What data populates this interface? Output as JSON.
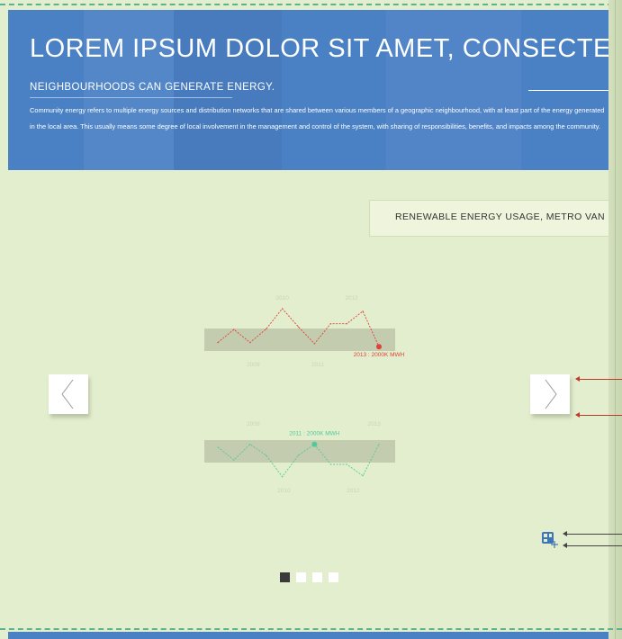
{
  "hero": {
    "title": "LOREM IPSUM DOLOR SIT AMET, CONSECTETUR",
    "subtitle": "NEIGHBOURHOODS CAN GENERATE ENERGY.",
    "body": "Community energy refers to multiple energy sources and distribution networks that are shared between various members of a geographic neighbourhood, with at least part of the energy generated in the local area. This usually means some degree of local involvement in the management and control of the system, with sharing of responsibilities, benefits, and impacts among the community."
  },
  "chart_box": {
    "title": "RENEWABLE ENERGY USAGE, METRO VAN"
  },
  "nav": {
    "prev_icon": "chevron-left-icon",
    "next_icon": "chevron-right-icon"
  },
  "tools": {
    "layout_icon": "layout-add-icon"
  },
  "pagination": {
    "count": 4,
    "active_index": 0
  },
  "colors": {
    "hero_bg": "#4a81c5",
    "page_bg": "#e2eecd",
    "red_series": "#e0413a",
    "green_series": "#53c99a",
    "band": "#c3ccae",
    "pointer_red": "#c0392b",
    "pager_active": "#3a3a3a"
  },
  "chart_data": [
    {
      "type": "line",
      "series": [
        {
          "points": [
            {
              "x": 0,
              "y": 0.3
            },
            {
              "x": 1,
              "y": 0.55
            },
            {
              "x": 2,
              "y": 0.3
            },
            {
              "x": 3,
              "y": 0.56
            },
            {
              "x": 4,
              "y": 0.95
            },
            {
              "x": 5,
              "y": 0.6
            },
            {
              "x": 6,
              "y": 0.28
            },
            {
              "x": 7,
              "y": 0.66
            },
            {
              "x": 8,
              "y": 0.66
            },
            {
              "x": 9,
              "y": 0.9
            },
            {
              "x": 10,
              "y": 0.22
            }
          ]
        }
      ],
      "tick_labels": [
        {
          "text": "2010",
          "at": 4,
          "pos": "above"
        },
        {
          "text": "2012",
          "at": 8.3,
          "pos": "above"
        },
        {
          "text": "2009",
          "at": 2.2,
          "pos": "below"
        },
        {
          "text": "2011",
          "at": 6.2,
          "pos": "below"
        }
      ],
      "highlight": {
        "at": 10,
        "label": "2013 : 2000K MWH"
      }
    },
    {
      "type": "line",
      "series": [
        {
          "points": [
            {
              "x": 0,
              "y": 0.72
            },
            {
              "x": 1,
              "y": 0.45
            },
            {
              "x": 2,
              "y": 0.78
            },
            {
              "x": 3,
              "y": 0.55
            },
            {
              "x": 4,
              "y": 0.1
            },
            {
              "x": 5,
              "y": 0.55
            },
            {
              "x": 6,
              "y": 0.78
            },
            {
              "x": 7,
              "y": 0.36
            },
            {
              "x": 8,
              "y": 0.36
            },
            {
              "x": 9,
              "y": 0.12
            },
            {
              "x": 10,
              "y": 0.78
            }
          ]
        }
      ],
      "tick_labels": [
        {
          "text": "2009",
          "at": 2.2,
          "pos": "above"
        },
        {
          "text": "2013",
          "at": 9.7,
          "pos": "above"
        },
        {
          "text": "2010",
          "at": 4.1,
          "pos": "below"
        },
        {
          "text": "2012",
          "at": 8.4,
          "pos": "below"
        }
      ],
      "highlight": {
        "at": 6,
        "label": "2011 : 2000K MWH"
      }
    }
  ]
}
